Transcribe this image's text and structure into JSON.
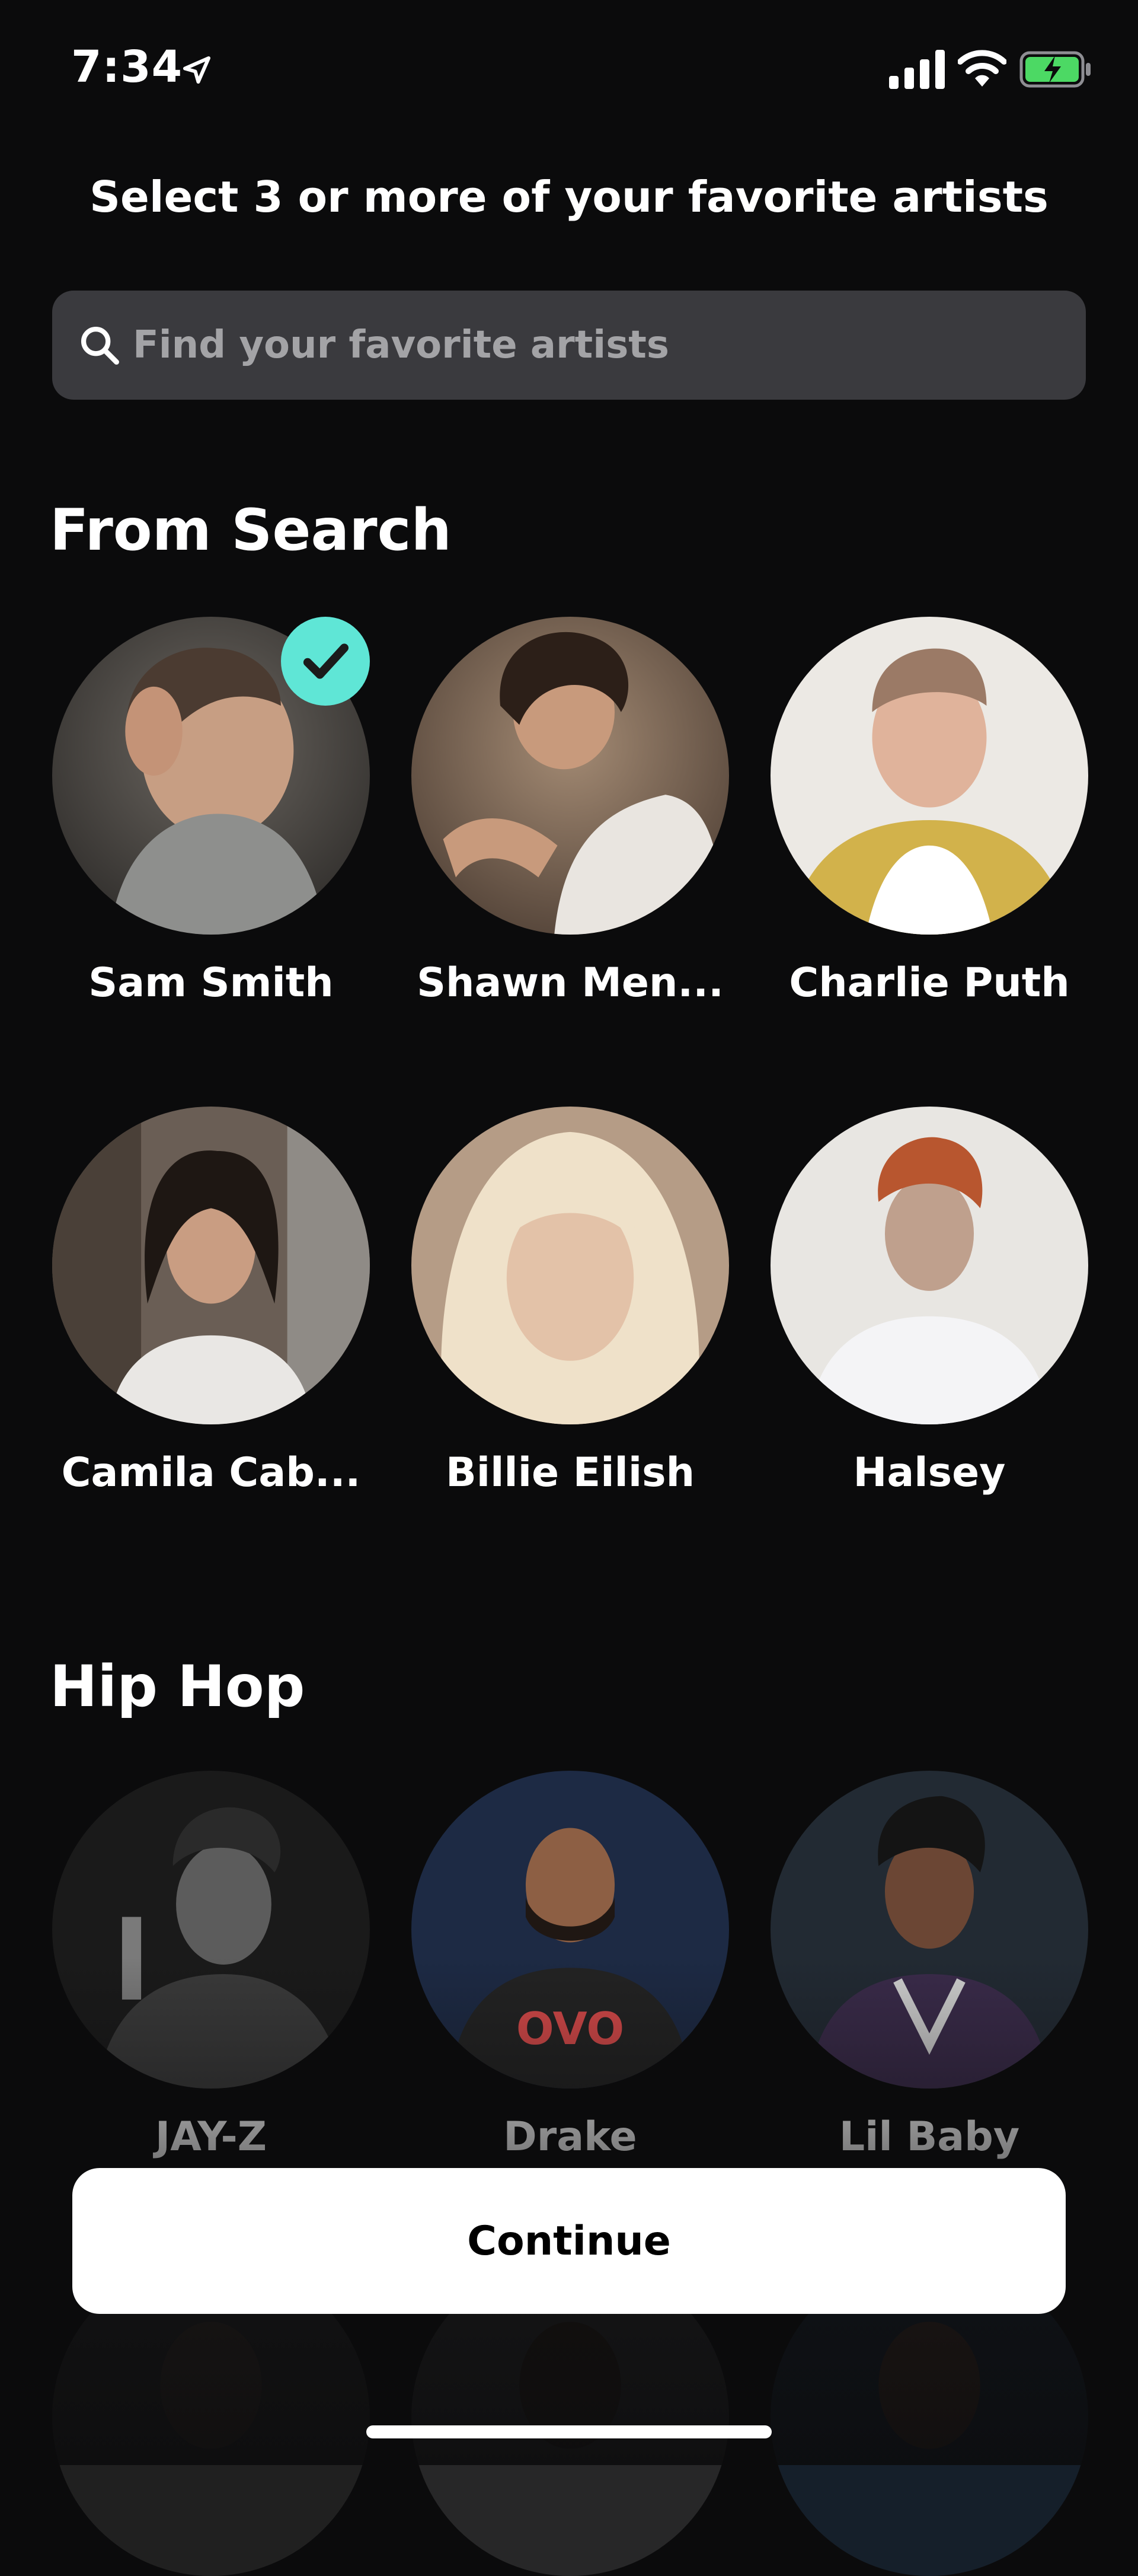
{
  "status_bar": {
    "time": "7:34",
    "icons": [
      "location-arrow-icon",
      "cellular-signal-icon",
      "wifi-icon",
      "battery-charging-icon"
    ],
    "battery_color": "#4cd964"
  },
  "header": {
    "prompt": "Select 3 or more of your favorite artists"
  },
  "search": {
    "placeholder": "Find your favorite artists",
    "value": ""
  },
  "sections": [
    {
      "title": "From Search",
      "artists": [
        {
          "name": "Sam Smith",
          "selected": true
        },
        {
          "name": "Shawn Men...",
          "selected": false
        },
        {
          "name": "Charlie Puth",
          "selected": false
        },
        {
          "name": "Camila Cab...",
          "selected": false
        },
        {
          "name": "Billie Eilish",
          "selected": false
        },
        {
          "name": "Halsey",
          "selected": false
        }
      ]
    },
    {
      "title": "Hip Hop",
      "artists": [
        {
          "name": "JAY-Z",
          "selected": false
        },
        {
          "name": "Drake",
          "selected": false
        },
        {
          "name": "Lil Baby",
          "selected": false
        }
      ]
    }
  ],
  "footer": {
    "continue_label": "Continue"
  },
  "colors": {
    "background": "#0b0b0c",
    "search_background": "#3a3a3e",
    "selected_badge": "#5fe6d6",
    "button_background": "#ffffff"
  }
}
